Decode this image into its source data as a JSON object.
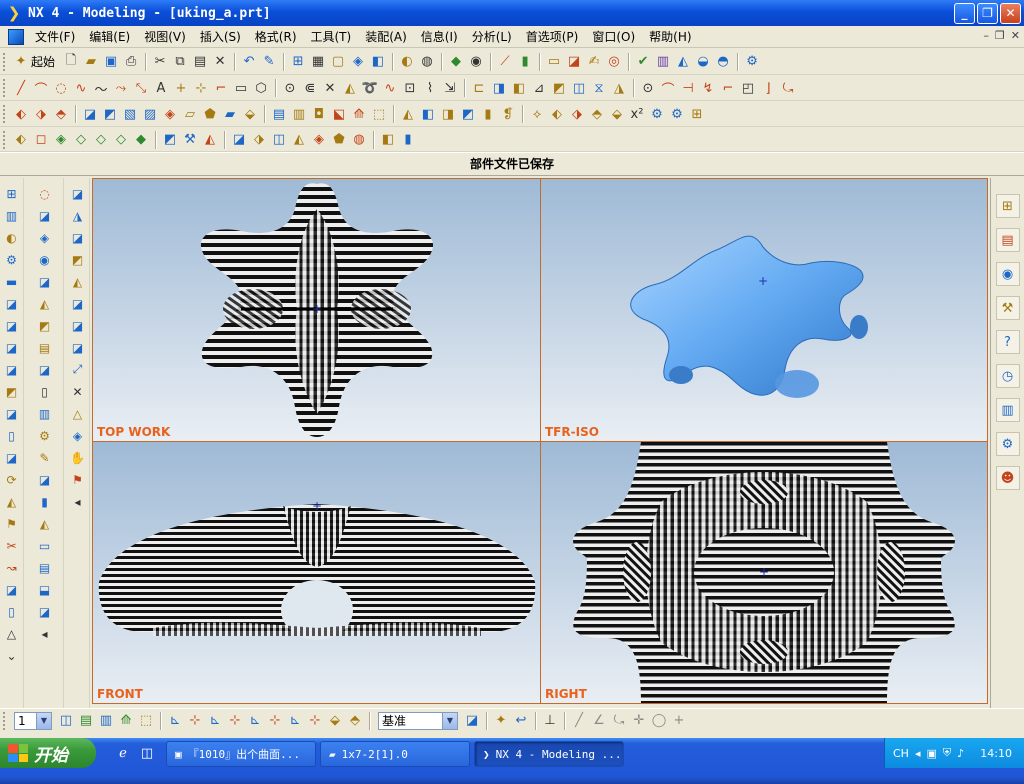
{
  "window": {
    "title": "NX 4 - Modeling - [uking_a.prt]"
  },
  "menu": [
    "文件(F)",
    "编辑(E)",
    "视图(V)",
    "插入(S)",
    "格式(R)",
    "工具(T)",
    "装配(A)",
    "信息(I)",
    "分析(L)",
    "首选项(P)",
    "窗口(O)",
    "帮助(H)"
  ],
  "toolbar": {
    "start_label": "起始"
  },
  "status": {
    "message": "部件文件已保存"
  },
  "viewports": [
    {
      "label": "TOP WORK",
      "view": "top"
    },
    {
      "label": "TFR-ISO",
      "view": "iso"
    },
    {
      "label": "FRONT",
      "view": "front"
    },
    {
      "label": "RIGHT",
      "view": "right"
    }
  ],
  "bottom_toolbar": {
    "layer_value": "1",
    "filter_value": "基准"
  },
  "taskbar": {
    "start_label": "开始",
    "tasks": [
      "『1010』出个曲面...",
      "1x7-2[1].0",
      "NX 4 - Modeling ..."
    ],
    "tray_lang": "CH",
    "clock": "14:10"
  }
}
